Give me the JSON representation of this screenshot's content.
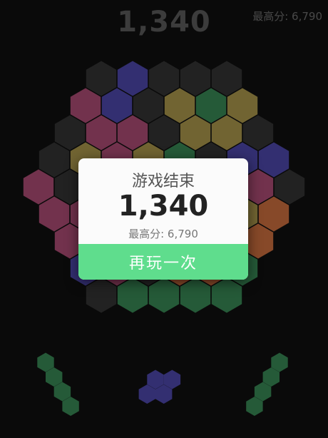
{
  "header": {
    "score": "1,340",
    "best_label": "最高分: 6,790"
  },
  "dialog": {
    "title": "游戏结束",
    "score": "1,340",
    "best_label": "最高分: 6,790",
    "replay_label": "再玩一次"
  },
  "colors": {
    "empty": "#2a2a2a",
    "blue": "#3f3a8a",
    "pink": "#8c3e5e",
    "olive": "#8a7a3e",
    "green": "#2e6e45",
    "orange": "#a55a33",
    "accent_button": "#5fdd8d"
  },
  "board_rows": [
    [
      "empty",
      "blue",
      "empty",
      "empty",
      "empty"
    ],
    [
      "pink",
      "blue",
      "empty",
      "olive",
      "green",
      "olive"
    ],
    [
      "empty",
      "pink",
      "pink",
      "empty",
      "olive",
      "olive",
      "empty"
    ],
    [
      "empty",
      "olive",
      "pink",
      "olive",
      "green",
      "empty",
      "blue",
      "blue"
    ],
    [
      "pink",
      "empty",
      "blue",
      "pink",
      "olive",
      "green",
      "pink",
      "pink",
      "empty"
    ],
    [
      "pink",
      "pink",
      "empty",
      "empty",
      "empty",
      "olive",
      "olive",
      "orange"
    ],
    [
      "pink",
      "empty",
      "empty",
      "empty",
      "empty",
      "empty",
      "orange"
    ],
    [
      "blue",
      "pink",
      "empty",
      "orange",
      "orange",
      "green"
    ],
    [
      "empty",
      "green",
      "green",
      "green",
      "green"
    ]
  ],
  "pieces": [
    {
      "color": "green",
      "cells": 4,
      "shape": "diagonal-down"
    },
    {
      "color": "blue",
      "cells": 4,
      "shape": "cluster"
    },
    {
      "color": "green",
      "cells": 4,
      "shape": "diagonal-up"
    }
  ]
}
